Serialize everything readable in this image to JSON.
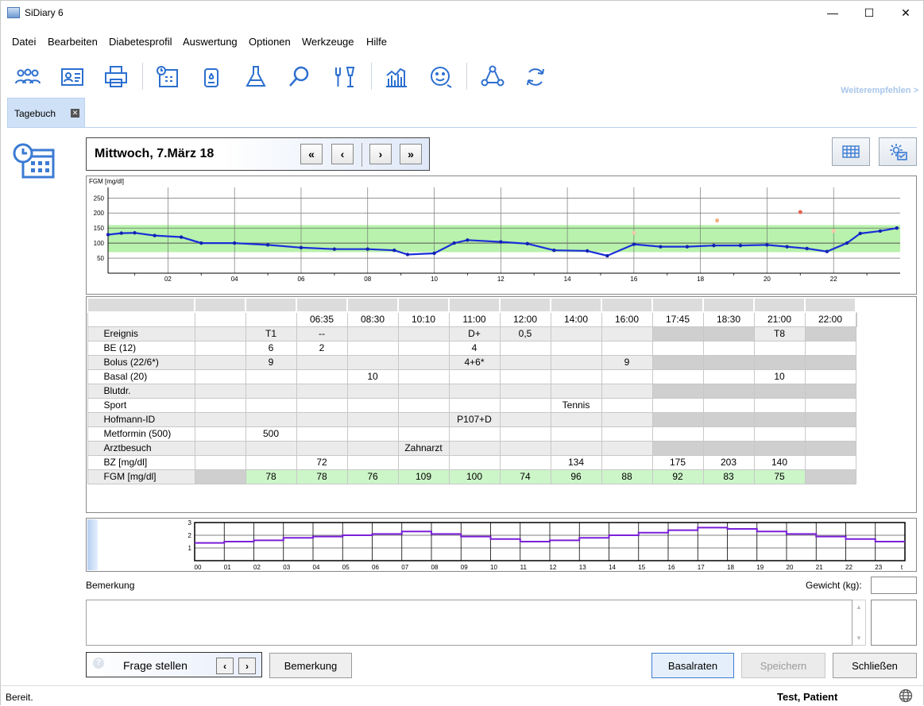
{
  "window": {
    "title": "SiDiary 6"
  },
  "menu": [
    "Datei",
    "Bearbeiten",
    "Diabetesprofil",
    "Auswertung",
    "Optionen",
    "Werkzeuge",
    "Hilfe"
  ],
  "toolbar": {
    "recommend": "Weiterempfehlen >"
  },
  "tab": {
    "label": "Tagebuch"
  },
  "date": {
    "title": "Mittwoch, 7.März 18",
    "nav": [
      "«",
      "‹",
      "›",
      "»"
    ]
  },
  "chart_data": {
    "type": "line",
    "ylabel": "FGM [mg/dl]",
    "yticks": [
      50,
      100,
      150,
      200,
      250
    ],
    "ylim": [
      0,
      285
    ],
    "xlim": [
      0.2,
      24
    ],
    "xticks": [
      "02",
      "04",
      "06",
      "08",
      "10",
      "12",
      "14",
      "16",
      "18",
      "20",
      "22"
    ],
    "target_range": [
      70,
      160
    ],
    "series": [
      {
        "x": [
          0.2,
          0.5,
          0.8,
          1.1,
          1.4,
          1.7,
          2.0,
          2.3,
          2.6,
          2.9,
          3.2,
          3.5,
          3.8,
          4.1,
          4.4,
          4.7,
          5.0,
          5.3,
          5.6,
          5.9,
          6.2,
          6.5,
          6.8,
          7.1,
          7.4,
          7.7,
          8.0,
          8.3,
          8.6,
          8.9,
          9.2,
          9.5,
          9.8,
          10.1,
          10.4,
          10.7,
          11.0,
          11.3,
          11.6,
          11.9,
          12.2,
          12.5,
          12.8,
          13.1,
          13.4,
          13.7,
          14.0,
          14.3,
          14.6,
          14.9,
          15.2,
          15.5,
          15.8,
          16.1,
          16.4,
          16.7,
          17.0,
          17.3,
          17.6,
          17.9,
          18.2,
          18.5,
          18.8,
          19.1,
          19.4,
          19.7,
          20.0,
          20.3,
          20.6,
          20.9,
          21.2,
          21.5,
          21.8,
          22.1,
          22.4,
          22.7,
          23.0,
          23.3,
          23.6,
          23.9
        ],
        "y": [
          128,
          133,
          134,
          131,
          127,
          124,
          123,
          121,
          116,
          107,
          98,
          98,
          100,
          100,
          98,
          96,
          94,
          92,
          88,
          85,
          84,
          82,
          80,
          79,
          78,
          78,
          78,
          80,
          78,
          76,
          75,
          74,
          76,
          78,
          78,
          77,
          74,
          72,
          68,
          70,
          70,
          70,
          76,
          68,
          64,
          60,
          62,
          62,
          65,
          62,
          70,
          100,
          110,
          108,
          106,
          104,
          102,
          101,
          100,
          99,
          96,
          90,
          86,
          82,
          78,
          77,
          75,
          74,
          76,
          80,
          78,
          79,
          80,
          74,
          72,
          70,
          66,
          64,
          60,
          58
        ]
      }
    ]
  },
  "chart_extra": {
    "points": [
      [
        0.2,
        128
      ],
      [
        0.5,
        133
      ],
      [
        0.8,
        134
      ],
      [
        1.4,
        127
      ],
      [
        1.7,
        124
      ],
      [
        2.0,
        123
      ],
      [
        2.3,
        121
      ],
      [
        2.6,
        116
      ],
      [
        3.2,
        98
      ],
      [
        3.5,
        98
      ],
      [
        3.8,
        100
      ],
      [
        4.1,
        100
      ],
      [
        4.4,
        98
      ],
      [
        4.7,
        96
      ],
      [
        5.0,
        94
      ],
      [
        5.6,
        88
      ],
      [
        5.9,
        85
      ],
      [
        6.2,
        84
      ],
      [
        6.5,
        82
      ],
      [
        7.1,
        79
      ],
      [
        7.4,
        78
      ],
      [
        8.0,
        78
      ],
      [
        8.6,
        78
      ],
      [
        9.2,
        75
      ],
      [
        9.5,
        74
      ],
      [
        9.8,
        76
      ],
      [
        10.4,
        78
      ],
      [
        11.0,
        74
      ],
      [
        11.6,
        68
      ],
      [
        12.2,
        70
      ],
      [
        12.8,
        76
      ],
      [
        13.4,
        64
      ],
      [
        14.0,
        62
      ],
      [
        14.6,
        65
      ],
      [
        15.2,
        70
      ],
      [
        15.8,
        100
      ],
      [
        16.1,
        110
      ],
      [
        16.4,
        108
      ],
      [
        17.0,
        104
      ],
      [
        17.6,
        101
      ],
      [
        18.2,
        96
      ],
      [
        18.8,
        86
      ],
      [
        19.4,
        78
      ],
      [
        20.0,
        75
      ],
      [
        20.3,
        74
      ],
      [
        21.2,
        78
      ],
      [
        21.8,
        80
      ],
      [
        22.1,
        74
      ],
      [
        22.7,
        70
      ],
      [
        23.3,
        64
      ],
      [
        23.9,
        58
      ]
    ],
    "markers": [
      {
        "x": 16.0,
        "y": 134,
        "color": "#f2c9a8"
      },
      {
        "x": 18.5,
        "y": 175,
        "color": "#f0b080"
      },
      {
        "x": 21.0,
        "y": 203,
        "color": "#e86050"
      },
      {
        "x": 22.0,
        "y": 140,
        "color": "#f2c9a8"
      }
    ],
    "trend": [
      [
        0.2,
        128
      ],
      [
        0.6,
        133
      ],
      [
        1.0,
        134
      ],
      [
        1.6,
        125
      ],
      [
        2.4,
        120
      ],
      [
        3.0,
        100
      ],
      [
        4.0,
        100
      ],
      [
        5.0,
        94
      ],
      [
        6.0,
        85
      ],
      [
        7.0,
        80
      ],
      [
        8.0,
        80
      ],
      [
        8.8,
        76
      ],
      [
        9.2,
        62
      ],
      [
        10.0,
        66
      ],
      [
        10.6,
        100
      ],
      [
        11.0,
        110
      ],
      [
        12.0,
        104
      ],
      [
        12.8,
        98
      ],
      [
        13.6,
        76
      ],
      [
        14.6,
        74
      ],
      [
        15.2,
        58
      ],
      [
        16.0,
        96
      ],
      [
        16.8,
        88
      ],
      [
        17.6,
        88
      ],
      [
        18.4,
        92
      ],
      [
        19.2,
        92
      ],
      [
        20.0,
        94
      ],
      [
        20.6,
        88
      ],
      [
        21.2,
        82
      ],
      [
        21.8,
        72
      ],
      [
        22.4,
        100
      ],
      [
        22.8,
        132
      ],
      [
        23.4,
        140
      ],
      [
        23.9,
        150
      ]
    ]
  },
  "table": {
    "times": [
      "06:35",
      "08:30",
      "10:10",
      "11:00",
      "12:00",
      "14:00",
      "16:00",
      "17:45",
      "18:30",
      "21:00",
      "22:00",
      ""
    ],
    "rows": [
      {
        "label": "Ereignis",
        "cells": [
          "",
          "",
          "T1",
          "--",
          "",
          "",
          "D+",
          "0,5",
          "",
          "",
          "",
          "",
          "T8",
          ""
        ]
      },
      {
        "label": "BE (12)",
        "cells": [
          "",
          "",
          "6",
          "2",
          "",
          "",
          "4",
          "",
          "",
          "",
          "",
          "",
          "",
          ""
        ]
      },
      {
        "label": "Bolus (22/6*)",
        "cells": [
          "",
          "",
          "9",
          "",
          "",
          "",
          "4+6*",
          "",
          "",
          "9",
          "",
          "",
          "",
          ""
        ]
      },
      {
        "label": "Basal (20)",
        "cells": [
          "",
          "",
          "",
          "",
          "10",
          "",
          "",
          "",
          "",
          "",
          "",
          "",
          "10",
          ""
        ]
      },
      {
        "label": "Blutdr.",
        "cells": [
          "",
          "",
          "",
          "",
          "",
          "",
          "",
          "",
          "",
          "",
          "",
          "",
          "",
          ""
        ]
      },
      {
        "label": "Sport",
        "cells": [
          "",
          "",
          "",
          "",
          "",
          "",
          "",
          "",
          "Tennis",
          "",
          "",
          "",
          "",
          ""
        ]
      },
      {
        "label": "Hofmann-ID",
        "cells": [
          "",
          "",
          "",
          "",
          "",
          "",
          "P107+D",
          "",
          "",
          "",
          "",
          "",
          "",
          ""
        ]
      },
      {
        "label": "Metformin (500)",
        "cells": [
          "",
          "",
          "500",
          "",
          "",
          "",
          "",
          "",
          "",
          "",
          "",
          "",
          "",
          ""
        ]
      },
      {
        "label": "Arztbesuch",
        "cells": [
          "",
          "",
          "",
          "",
          "",
          "Zahnarzt",
          "",
          "",
          "",
          "",
          "",
          "",
          "",
          ""
        ]
      },
      {
        "label": "BZ [mg/dl]",
        "cells": [
          "",
          "",
          "",
          "72",
          "",
          "",
          "",
          "",
          "134",
          "",
          "175",
          "203",
          "140",
          ""
        ]
      },
      {
        "label": "FGM [mg/dl]",
        "cells": [
          "",
          "",
          "78",
          "78",
          "76",
          "109",
          "100",
          "74",
          "96",
          "88",
          "92",
          "83",
          "75",
          ""
        ]
      }
    ]
  },
  "basal_chart": {
    "yticks": [
      "1",
      "2",
      "3"
    ],
    "ylim": [
      0,
      3
    ],
    "xticks": [
      "00",
      "01",
      "02",
      "03",
      "04",
      "05",
      "06",
      "07",
      "08",
      "09",
      "10",
      "11",
      "12",
      "13",
      "14",
      "15",
      "16",
      "17",
      "18",
      "19",
      "20",
      "21",
      "22",
      "23",
      "t"
    ],
    "values": [
      1.4,
      1.5,
      1.6,
      1.8,
      1.9,
      2.0,
      2.1,
      2.3,
      2.1,
      1.9,
      1.7,
      1.5,
      1.6,
      1.8,
      2.0,
      2.2,
      2.4,
      2.6,
      2.5,
      2.3,
      2.1,
      1.9,
      1.7,
      1.5
    ]
  },
  "remark": {
    "label": "Bemerkung",
    "weight_label": "Gewicht (kg):",
    "value": ""
  },
  "buttons": {
    "ask": "Frage stellen",
    "remark": "Bemerkung",
    "basal": "Basalraten",
    "save": "Speichern",
    "close": "Schließen"
  },
  "status": {
    "text": "Bereit.",
    "user": "Test, Patient"
  }
}
